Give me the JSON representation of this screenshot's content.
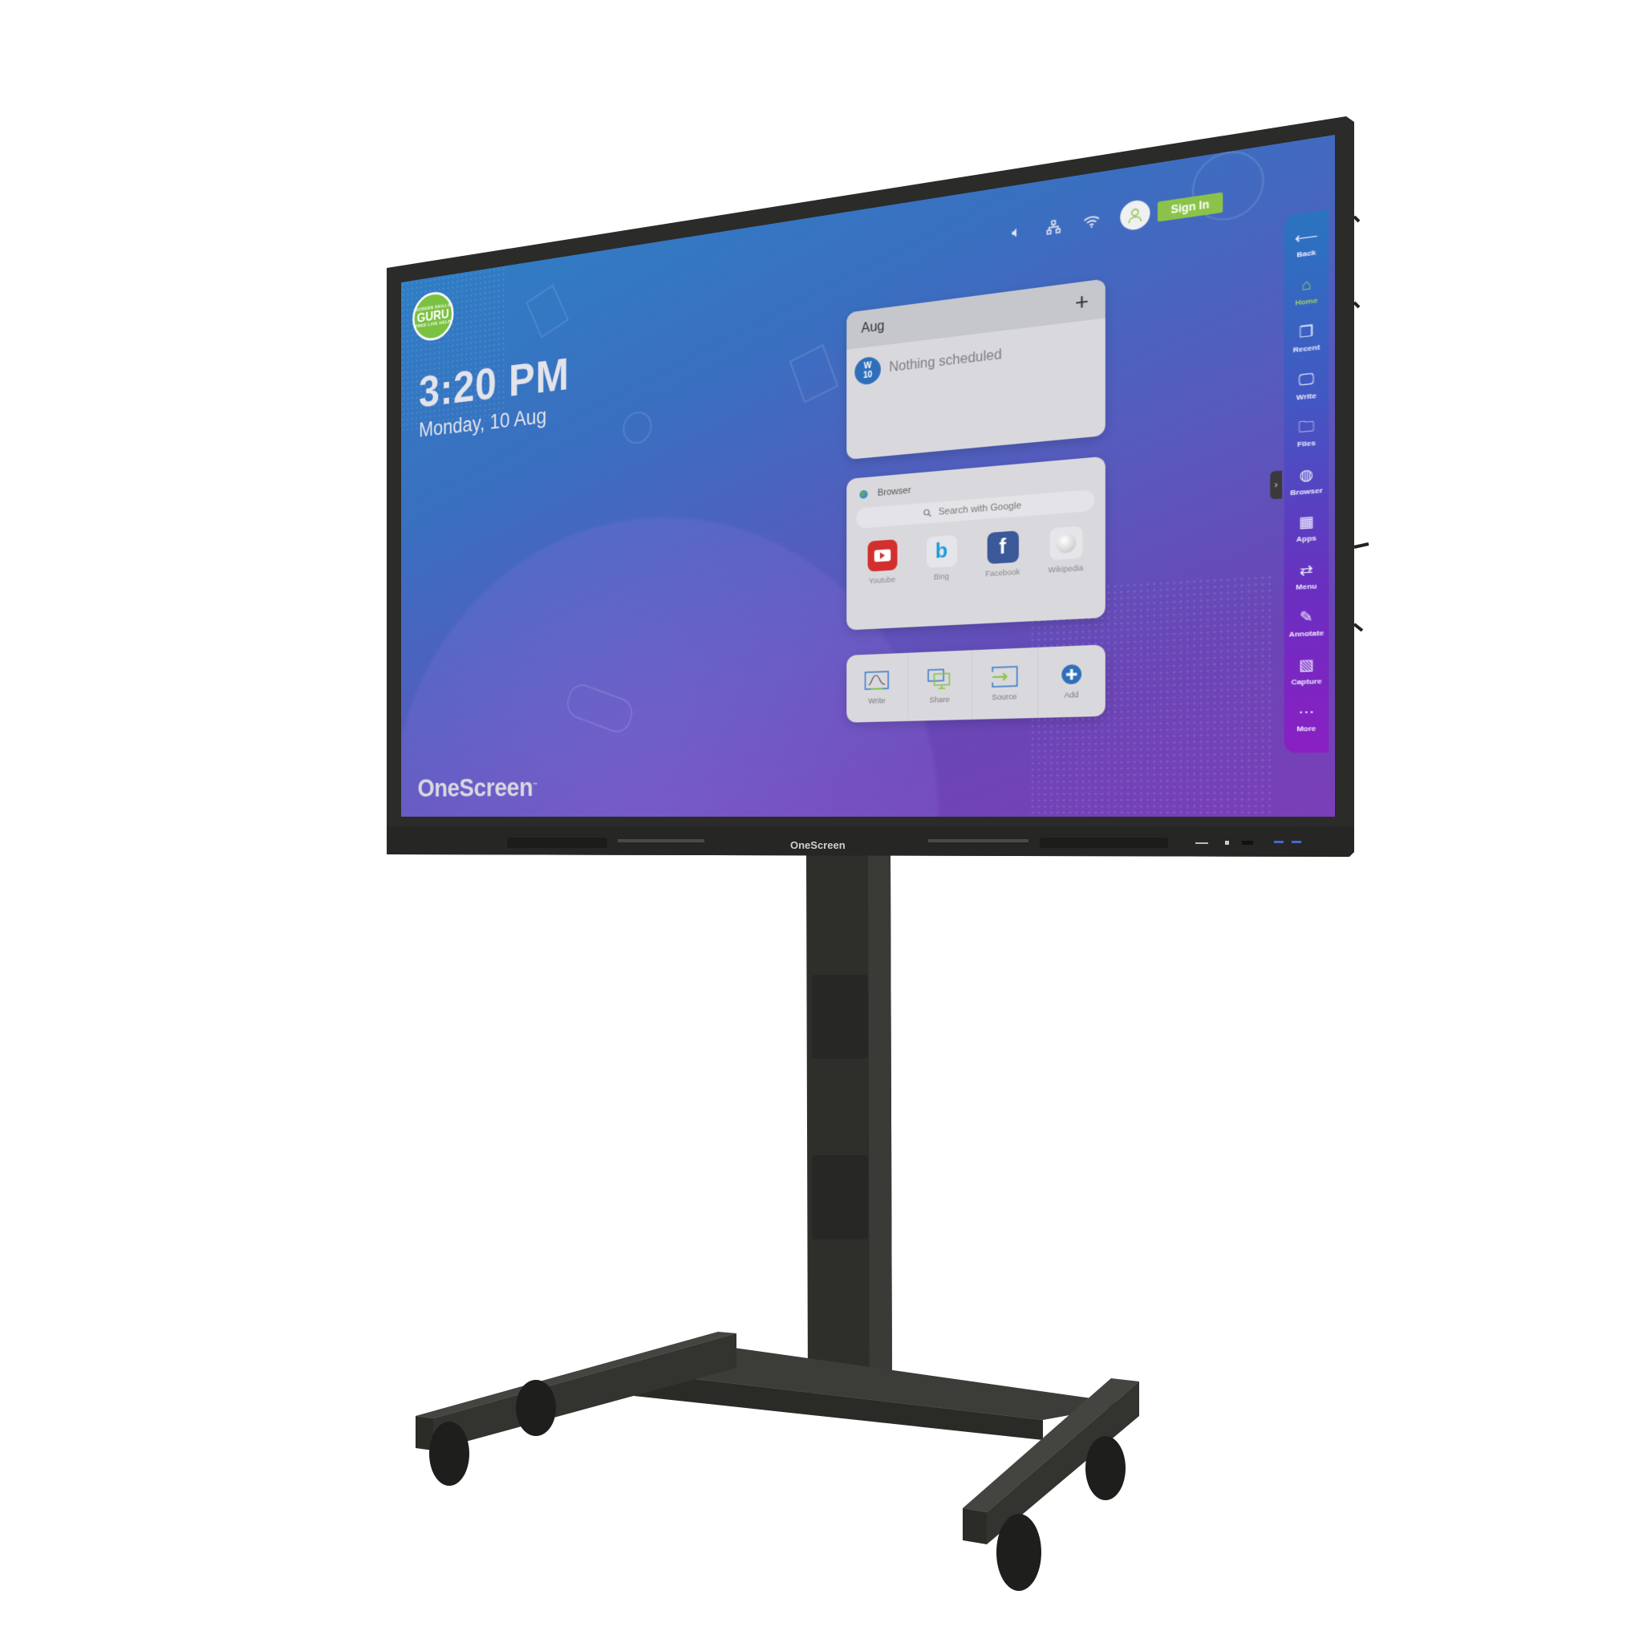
{
  "device": {
    "brand": "OneScreen",
    "bezel_logo": "OneScreen"
  },
  "home": {
    "guru_badge": {
      "top_text": "SCREEN SKILLS",
      "main_text": "GURU",
      "bottom_text": "FREE LIVE HELP"
    },
    "time": "3:20 PM",
    "date": "Monday, 10 Aug",
    "brand_logo": "OneScreen"
  },
  "status_bar": {
    "icons": [
      "volume-icon",
      "network-icon",
      "wifi-icon"
    ],
    "sign_in_label": "Sign In"
  },
  "calendar_widget": {
    "month": "Aug",
    "add_label": "+",
    "day_badge": {
      "weekday": "W",
      "day": "10"
    },
    "empty_text": "Nothing scheduled"
  },
  "browser_widget": {
    "title": "Browser",
    "search_placeholder": "Search with Google",
    "shortcuts": [
      {
        "label": "Youtube",
        "icon": "youtube-icon",
        "color": "#d32f2f"
      },
      {
        "label": "Bing",
        "icon": "bing-icon",
        "color": "#1e9bd7"
      },
      {
        "label": "Facebook",
        "icon": "facebook-icon",
        "color": "#3b5998"
      },
      {
        "label": "Wikipedia",
        "icon": "wikipedia-icon",
        "color": "#eeeeee"
      }
    ]
  },
  "quick_actions": [
    {
      "label": "Write",
      "icon": "whiteboard-icon"
    },
    {
      "label": "Share",
      "icon": "screen-share-icon"
    },
    {
      "label": "Source",
      "icon": "input-source-icon"
    },
    {
      "label": "Add",
      "icon": "add-icon"
    }
  ],
  "sidebar": {
    "items": [
      {
        "label": "Back",
        "icon": "back-arrow-icon",
        "glyph": "⟵"
      },
      {
        "label": "Home",
        "icon": "home-icon",
        "glyph": "⌂",
        "active": true
      },
      {
        "label": "Recent",
        "icon": "recent-icon",
        "glyph": "❐"
      },
      {
        "label": "Write",
        "icon": "write-icon",
        "glyph": "🖵"
      },
      {
        "label": "Files",
        "icon": "folder-icon",
        "glyph": "🗀"
      },
      {
        "label": "Browser",
        "icon": "globe-icon",
        "glyph": "◍"
      },
      {
        "label": "Apps",
        "icon": "apps-grid-icon",
        "glyph": "▦"
      },
      {
        "label": "Menu",
        "icon": "menu-switch-icon",
        "glyph": "⇄"
      },
      {
        "label": "Annotate",
        "icon": "highlighter-icon",
        "glyph": "✎"
      },
      {
        "label": "Capture",
        "icon": "capture-icon",
        "glyph": "▧"
      },
      {
        "label": "More",
        "icon": "more-icon",
        "glyph": "⋯"
      }
    ],
    "toggle_glyph": "›"
  },
  "colors": {
    "accent_green": "#8bc34a",
    "sidebar_top": "#2a74c0",
    "sidebar_bottom": "#8a1fc2",
    "bezel": "#2b2b29",
    "stand": "#2f2f2c"
  }
}
